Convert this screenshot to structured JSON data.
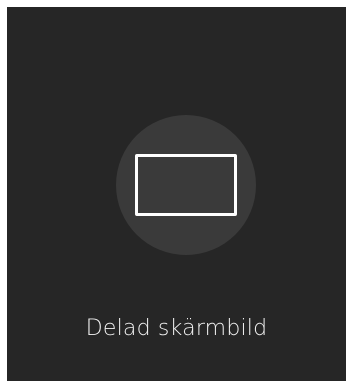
{
  "tile": {
    "label": "Delad skärmbild",
    "icon": "screen-frame-icon",
    "background_color": "#262626",
    "icon_circle_color": "#3a3a3a",
    "text_color": "#f2f2f2"
  }
}
